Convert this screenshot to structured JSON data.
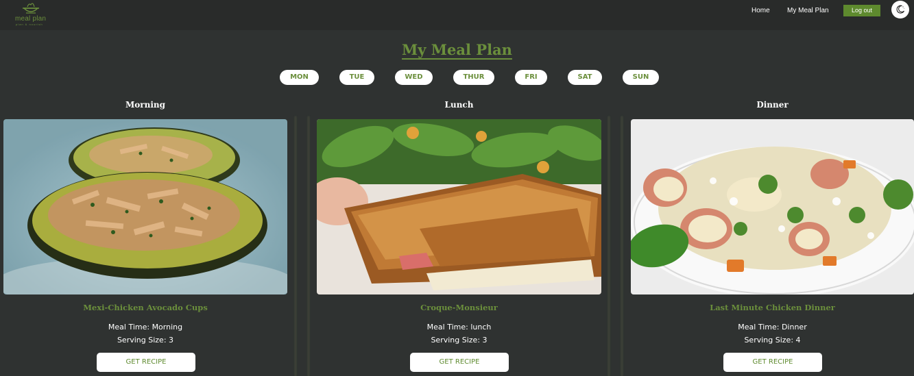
{
  "nav": {
    "logo_text": "meal plan",
    "logo_tagline": "plan & nourish",
    "home": "Home",
    "my_meal_plan": "My Meal Plan",
    "logout": "Log out"
  },
  "page": {
    "title": "My Meal Plan"
  },
  "days": [
    "MON",
    "TUE",
    "WED",
    "THUR",
    "FRI",
    "SAT",
    "SUN"
  ],
  "meals": [
    {
      "heading": "Morning",
      "name": "Mexi-Chicken Avocado Cups",
      "meal_time": "Meal Time: Morning",
      "serving_size": "Serving Size: 3",
      "button": "GET RECIPE"
    },
    {
      "heading": "Lunch",
      "name": "Croque-Monsieur",
      "meal_time": "Meal Time: lunch",
      "serving_size": "Serving Size: 3",
      "button": "GET RECIPE"
    },
    {
      "heading": "Dinner",
      "name": "Last Minute Chicken Dinner",
      "meal_time": "Meal Time: Dinner",
      "serving_size": "Serving Size: 4",
      "button": "GET RECIPE"
    }
  ],
  "colors": {
    "accent": "#6b8f3c",
    "button_green": "#5e8a2e",
    "background": "#2f3231",
    "navbar": "#292b2a"
  },
  "icons": {
    "logo": "bowl-icon",
    "theme_toggle": "moon-icon"
  }
}
